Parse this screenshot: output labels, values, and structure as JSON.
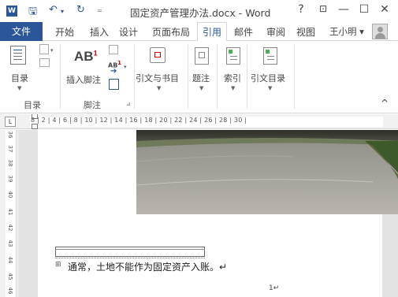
{
  "window": {
    "app_badge": "W",
    "title": "固定资产管理办法.docx - Word",
    "help": "?",
    "ribbon_display": "⊡",
    "minimize": "—",
    "maximize": "☐",
    "close": "✕"
  },
  "qat": {
    "save": "🖫",
    "undo": "↶",
    "undo_caret": "▾",
    "redo": "↻",
    "customize": "₌"
  },
  "tabs": {
    "file": "文件",
    "items": [
      "开始",
      "插入",
      "设计",
      "页面布局",
      "引用",
      "邮件",
      "审阅",
      "视图"
    ],
    "active": "引用",
    "user": "王小明 ▾"
  },
  "ribbon": {
    "toc": {
      "label": "目录",
      "group": "目录"
    },
    "footnote": {
      "label": "插入脚注",
      "ab_text": "AB",
      "ab_sup": "1",
      "ab2": "AB",
      "group": "脚注",
      "launcher": "⊿"
    },
    "citations": {
      "label": "引文与书目"
    },
    "captions": {
      "label": "题注"
    },
    "index": {
      "label": "索引"
    },
    "toa": {
      "label": "引文目录"
    },
    "collapse": "^"
  },
  "ruler": {
    "corner": "L",
    "ticks": "8  |  2  |  4  |  6  |  8  | 10 | 12 | 14 | 16 | 18 | 20 | 22 | 24 | 26 | 28 | 30 |"
  },
  "vruler": [
    "36",
    "37",
    "38",
    "39",
    "40",
    "41",
    "42",
    "43",
    "44",
    "45",
    "46"
  ],
  "document": {
    "body_text": "通常，土地不能作为固定资产入账。↵",
    "anchor": "⊞",
    "page_number": "1↵"
  }
}
